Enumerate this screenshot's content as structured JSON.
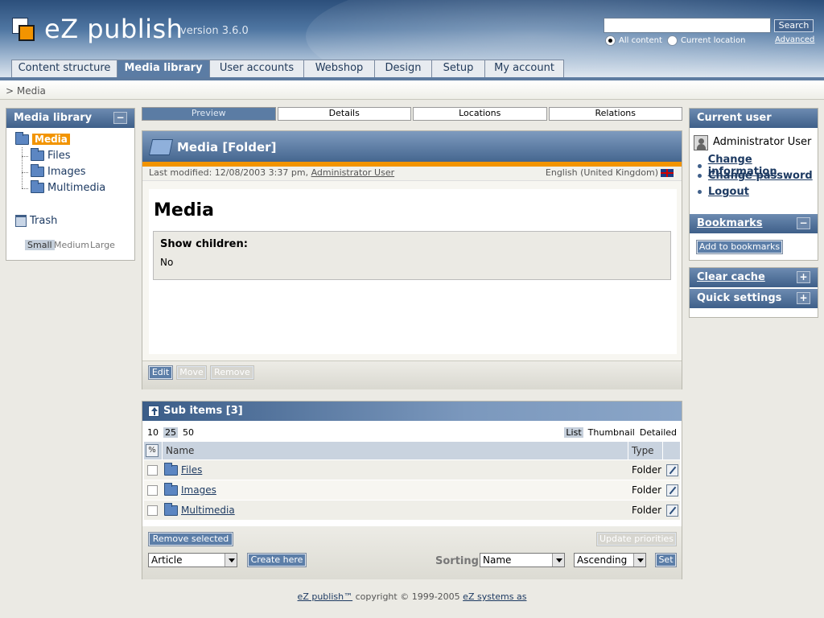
{
  "header": {
    "logo_text": "eZ publish",
    "version": "version 3.6.0",
    "search": {
      "value": "",
      "button": "Search",
      "advanced": "Advanced",
      "option_all": "All content",
      "option_current": "Current location",
      "selected": "All content"
    }
  },
  "tabs": [
    {
      "label": "Content structure",
      "active": false
    },
    {
      "label": "Media library",
      "active": true
    },
    {
      "label": "User accounts",
      "active": false
    },
    {
      "label": "Webshop",
      "active": false
    },
    {
      "label": "Design",
      "active": false
    },
    {
      "label": "Setup",
      "active": false
    },
    {
      "label": "My account",
      "active": false
    }
  ],
  "breadcrumb": "> Media",
  "left_panel": {
    "title": "Media library",
    "collapse": "−",
    "tree": {
      "root": "Media",
      "children": [
        "Files",
        "Images",
        "Multimedia"
      ],
      "trash": "Trash"
    },
    "sizes": {
      "small": "Small",
      "medium": "Medium",
      "large": "Large",
      "selected": "Small"
    }
  },
  "view_tabs": [
    {
      "label": "Preview",
      "active": true
    },
    {
      "label": "Details",
      "active": false
    },
    {
      "label": "Locations",
      "active": false
    },
    {
      "label": "Relations",
      "active": false
    }
  ],
  "content": {
    "header_title": "Media [Folder]",
    "modified_prefix": "Last modified: 12/08/2003 3:37 pm, ",
    "modified_user": "Administrator User",
    "language": "English (United Kingdom)",
    "page_title": "Media",
    "attribute_label": "Show children:",
    "attribute_value": "No",
    "buttons": {
      "edit": "Edit",
      "move": "Move",
      "remove": "Remove"
    }
  },
  "sub_items": {
    "header_title": "Sub items [3]",
    "limits": [
      "10",
      "25",
      "50"
    ],
    "limit_selected": "25",
    "view_modes": [
      "List",
      "Thumbnail",
      "Detailed"
    ],
    "view_selected": "List",
    "columns": {
      "toggle": "%",
      "name": "Name",
      "type": "Type"
    },
    "rows": [
      {
        "name": "Files",
        "type": "Folder"
      },
      {
        "name": "Images",
        "type": "Folder"
      },
      {
        "name": "Multimedia",
        "type": "Folder"
      }
    ],
    "buttons": {
      "remove_selected": "Remove selected",
      "update_priorities": "Update priorities",
      "create_here": "Create here",
      "set": "Set"
    },
    "create_class": "Article",
    "sorting_label": "Sorting:",
    "sort_field": "Name",
    "sort_order": "Ascending"
  },
  "right_panel": {
    "current_user_title": "Current user",
    "user_name": "Administrator User",
    "links": [
      "Change information",
      "Change password",
      "Logout"
    ],
    "bookmarks_title": "Bookmarks",
    "bookmarks_toggle": "−",
    "add_bookmarks": "Add to bookmarks",
    "clear_cache_title": "Clear cache",
    "quick_settings_title": "Quick settings",
    "expand": "+"
  },
  "footer": {
    "product": "eZ publish™",
    "copyright": " copyright © 1999-2005 ",
    "company": "eZ systems as"
  }
}
